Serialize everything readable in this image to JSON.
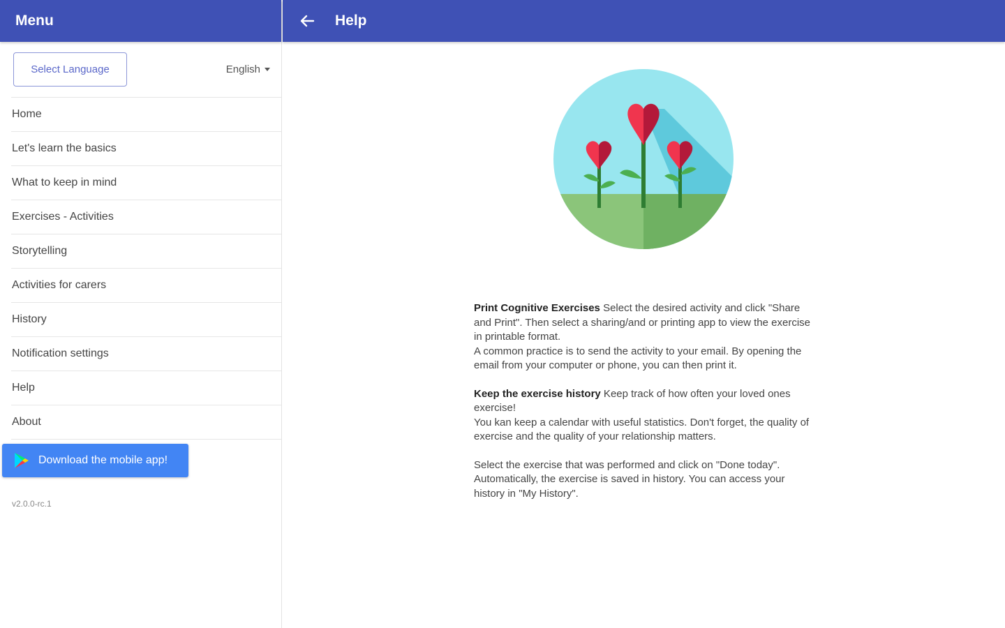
{
  "sidebar": {
    "title": "Menu",
    "language_button": "Select Language",
    "language_selected": "English",
    "items": [
      "Home",
      "Let's learn the basics",
      "What to keep in mind",
      "Exercises - Activities",
      "Storytelling",
      "Activities for carers",
      "History",
      "Notification settings",
      "Help",
      "About"
    ],
    "download_label": "Download the mobile app!",
    "version": "v2.0.0-rc.1"
  },
  "header": {
    "title": "Help"
  },
  "help": {
    "p1_title": "Print Cognitive Exercises",
    "p1_text": " Select the desired activity and click \"Share and Print\". Then select a sharing/and or printing app to view the exercise in printable format.",
    "p1_text2": "A common practice is to send the activity to your email. By opening the email from your computer or phone, you can then print it.",
    "p2_title": "Keep the exercise history",
    "p2_text": " Keep track of how often your loved ones exercise!",
    "p2_text2": "You kan keep a calendar with useful statistics. Don't forget, the quality of exercise and the quality of your relationship matters.",
    "p3_text": "Select the exercise that was performed and click on \"Done today\". Automatically, the exercise is saved in history. You can access your history in \"My History\"."
  },
  "colors": {
    "primary": "#3f51b5",
    "download": "#4285f4",
    "heart": "#e8334a",
    "sky": "#98e6ef",
    "grass": "#7dbf6e"
  },
  "icons": {
    "back": "arrow-left-icon",
    "store": "play-store-icon",
    "caret": "caret-down-icon"
  }
}
